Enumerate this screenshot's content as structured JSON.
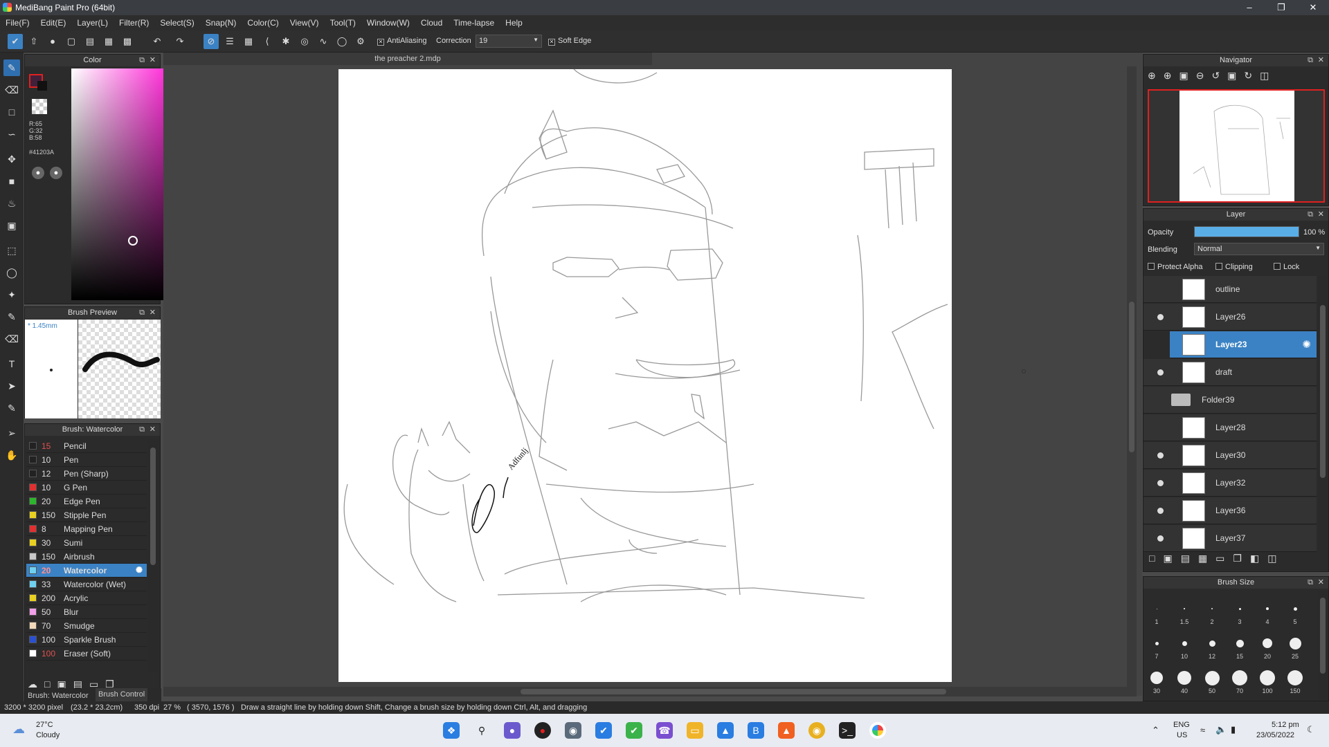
{
  "window": {
    "title": "MediBang Paint Pro (64bit)"
  },
  "menu": [
    "File(F)",
    "Edit(E)",
    "Layer(L)",
    "Filter(R)",
    "Select(S)",
    "Snap(N)",
    "Color(C)",
    "View(V)",
    "Tool(T)",
    "Window(W)",
    "Cloud",
    "Time-lapse",
    "Help"
  ],
  "toolbar": {
    "antialiasing_label": "AntiAliasing",
    "correction_label": "Correction",
    "correction_value": "19",
    "soft_edge_label": "Soft Edge"
  },
  "color_panel": {
    "title": "Color",
    "r": "R:65",
    "g": "G:32",
    "b": "B:58",
    "hex": "#41203A",
    "primary_color": "#41203A"
  },
  "brush_preview": {
    "title": "Brush Preview",
    "size": "* 1.45mm"
  },
  "brush_panel": {
    "title": "Brush: Watercolor",
    "items": [
      {
        "size": "15",
        "name": "Pencil",
        "color": "#222222",
        "size_red": true
      },
      {
        "size": "10",
        "name": "Pen",
        "color": "#222222"
      },
      {
        "size": "12",
        "name": "Pen (Sharp)",
        "color": "#222222"
      },
      {
        "size": "10",
        "name": "G Pen",
        "color": "#e03030"
      },
      {
        "size": "20",
        "name": "Edge Pen",
        "color": "#2db52d"
      },
      {
        "size": "150",
        "name": "Stipple Pen",
        "color": "#e8d020"
      },
      {
        "size": "8",
        "name": "Mapping Pen",
        "color": "#e03030"
      },
      {
        "size": "30",
        "name": "Sumi",
        "color": "#e8d020"
      },
      {
        "size": "150",
        "name": "Airbrush",
        "color": "#c8c8c8"
      },
      {
        "size": "20",
        "name": "Watercolor",
        "color": "#6fd0f0",
        "selected": true
      },
      {
        "size": "33",
        "name": "Watercolor (Wet)",
        "color": "#6fd0f0"
      },
      {
        "size": "200",
        "name": "Acrylic",
        "color": "#e8d020"
      },
      {
        "size": "50",
        "name": "Blur",
        "color": "#f0a0e8"
      },
      {
        "size": "70",
        "name": "Smudge",
        "color": "#f0d8b8"
      },
      {
        "size": "100",
        "name": "Sparkle Brush",
        "color": "#2a50d0"
      },
      {
        "size": "100",
        "name": "Eraser (Soft)",
        "color": "#ffffff",
        "size_red": true
      }
    ],
    "bottom_tabs": [
      "Brush: Watercolor",
      "Brush Control"
    ]
  },
  "document": {
    "tab": "the preacher 2.mdp"
  },
  "navigator": {
    "title": "Navigator"
  },
  "layer_panel": {
    "title": "Layer",
    "opacity_label": "Opacity",
    "opacity_value": "100 %",
    "opacity_fraction": 1.0,
    "blending_label": "Blending",
    "blending_value": "Normal",
    "protect_alpha": "Protect Alpha",
    "clipping": "Clipping",
    "lock": "Lock",
    "layers": [
      {
        "name": "outline",
        "visible": false
      },
      {
        "name": "Layer26",
        "visible": true
      },
      {
        "name": "Layer23",
        "visible": false,
        "selected": true
      },
      {
        "name": "draft",
        "visible": true
      },
      {
        "name": "Folder39",
        "folder": true
      },
      {
        "name": "Layer28",
        "visible": false
      },
      {
        "name": "Layer30",
        "visible": true
      },
      {
        "name": "Layer32",
        "visible": true
      },
      {
        "name": "Layer36",
        "visible": true
      },
      {
        "name": "Layer37",
        "visible": true
      }
    ]
  },
  "brush_size_panel": {
    "title": "Brush Size",
    "sizes": [
      "1",
      "1.5",
      "2",
      "3",
      "4",
      "5",
      "7",
      "10",
      "12",
      "15",
      "20",
      "25",
      "30",
      "40",
      "50",
      "70",
      "100",
      "150"
    ]
  },
  "statusbar": {
    "dimensions": "3200 * 3200 pixel",
    "physical": "(23.2 * 23.2cm)",
    "dpi": "350 dpi",
    "zoom": "27 %",
    "coords": "( 3570, 1576 )",
    "hint": "Draw a straight line by holding down Shift, Change a brush size by holding down Ctrl, Alt, and dragging"
  },
  "taskbar": {
    "temp": "27°C",
    "weather": "Cloudy",
    "lang1": "ENG",
    "lang2": "US",
    "time": "5:12 pm",
    "date": "23/05/2022"
  }
}
